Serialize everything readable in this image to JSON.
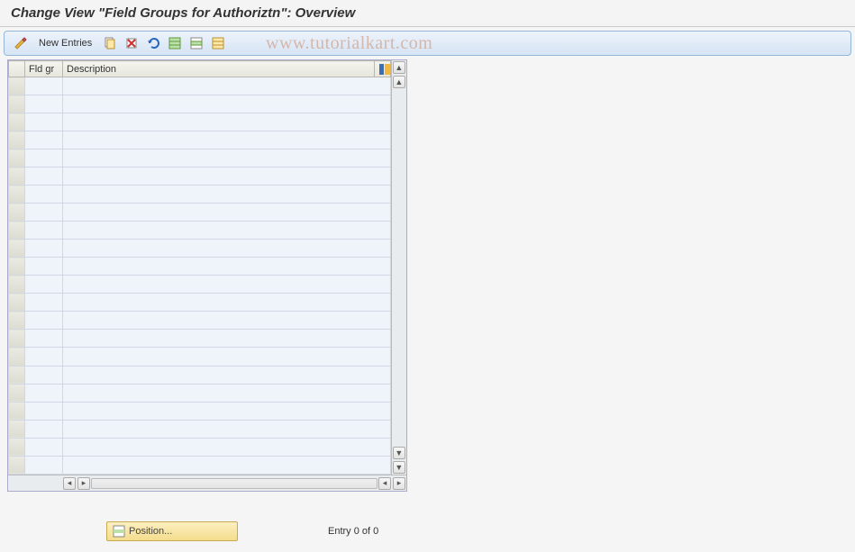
{
  "title": "Change View \"Field Groups for Authoriztn\": Overview",
  "toolbar": {
    "new_entries_label": "New Entries"
  },
  "table": {
    "columns": {
      "fld_gr": "Fld gr",
      "description": "Description"
    },
    "row_count": 22
  },
  "footer": {
    "position_label": "Position...",
    "entry_text": "Entry 0 of 0"
  },
  "watermark": "www.tutorialkart.com"
}
